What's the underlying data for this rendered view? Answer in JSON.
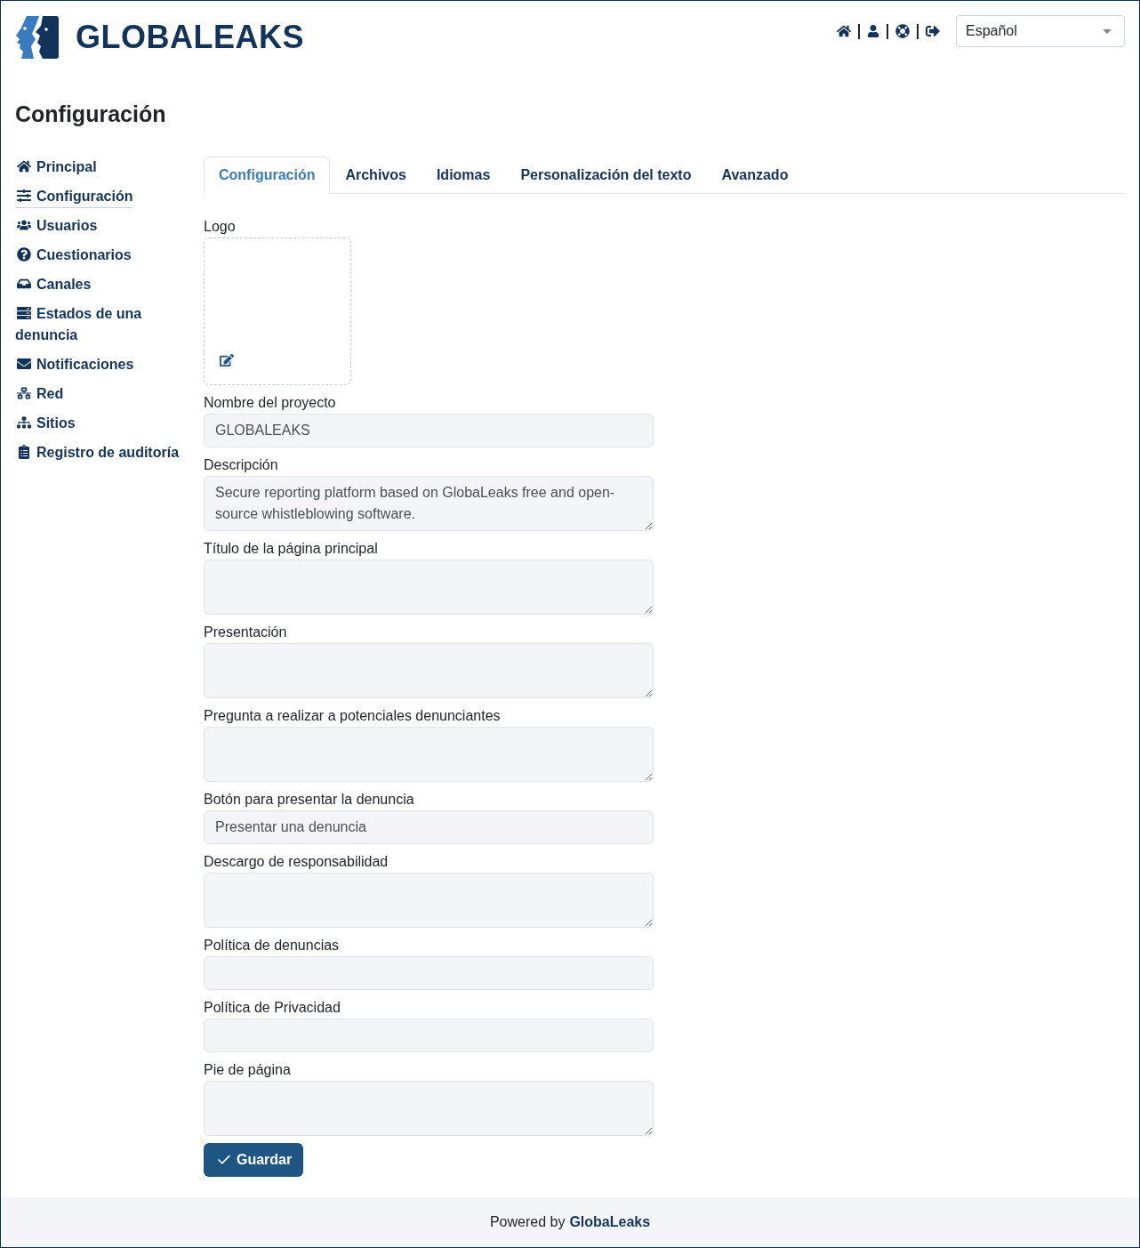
{
  "header": {
    "logo_text": "GLOBALEAKS",
    "language": "Español"
  },
  "page_title": "Configuración",
  "sidebar": {
    "items": [
      {
        "label": "Principal",
        "selected": false
      },
      {
        "label": "Configuración",
        "selected": true
      },
      {
        "label": "Usuarios",
        "selected": false
      },
      {
        "label": "Cuestionarios",
        "selected": false
      },
      {
        "label": "Canales",
        "selected": false
      },
      {
        "label": "Estados de una denuncia",
        "selected": false
      },
      {
        "label": "Notificaciones",
        "selected": false
      },
      {
        "label": "Red",
        "selected": false
      },
      {
        "label": "Sitios",
        "selected": false
      },
      {
        "label": "Registro de auditoría",
        "selected": false
      }
    ]
  },
  "tabs": [
    {
      "label": "Configuración",
      "selected": true
    },
    {
      "label": "Archivos",
      "selected": false
    },
    {
      "label": "Idiomas",
      "selected": false
    },
    {
      "label": "Personalización del texto",
      "selected": false
    },
    {
      "label": "Avanzado",
      "selected": false
    }
  ],
  "form": {
    "fields": [
      {
        "kind": "logo",
        "label": "Logo"
      },
      {
        "kind": "input",
        "label": "Nombre del proyecto",
        "value": "GLOBALEAKS"
      },
      {
        "kind": "textarea",
        "label": "Descripción",
        "value": "Secure reporting platform based on GlobaLeaks free and open-source whistleblowing software."
      },
      {
        "kind": "textarea",
        "label": "Título de la página principal"
      },
      {
        "kind": "textarea",
        "label": "Presentación"
      },
      {
        "kind": "textarea",
        "label": "Pregunta a realizar a potenciales denunciantes"
      },
      {
        "kind": "input",
        "label": "Botón para presentar la denuncia",
        "value": "Presentar una denuncia"
      },
      {
        "kind": "textarea",
        "label": "Descargo de responsabilidad"
      },
      {
        "kind": "input",
        "label": "Política de denuncias"
      },
      {
        "kind": "input",
        "label": "Política de Privacidad"
      },
      {
        "kind": "textarea",
        "label": "Pie de página"
      }
    ],
    "save_button": "Guardar"
  },
  "footer": {
    "text": "Powered by",
    "link": "GlobaLeaks"
  }
}
